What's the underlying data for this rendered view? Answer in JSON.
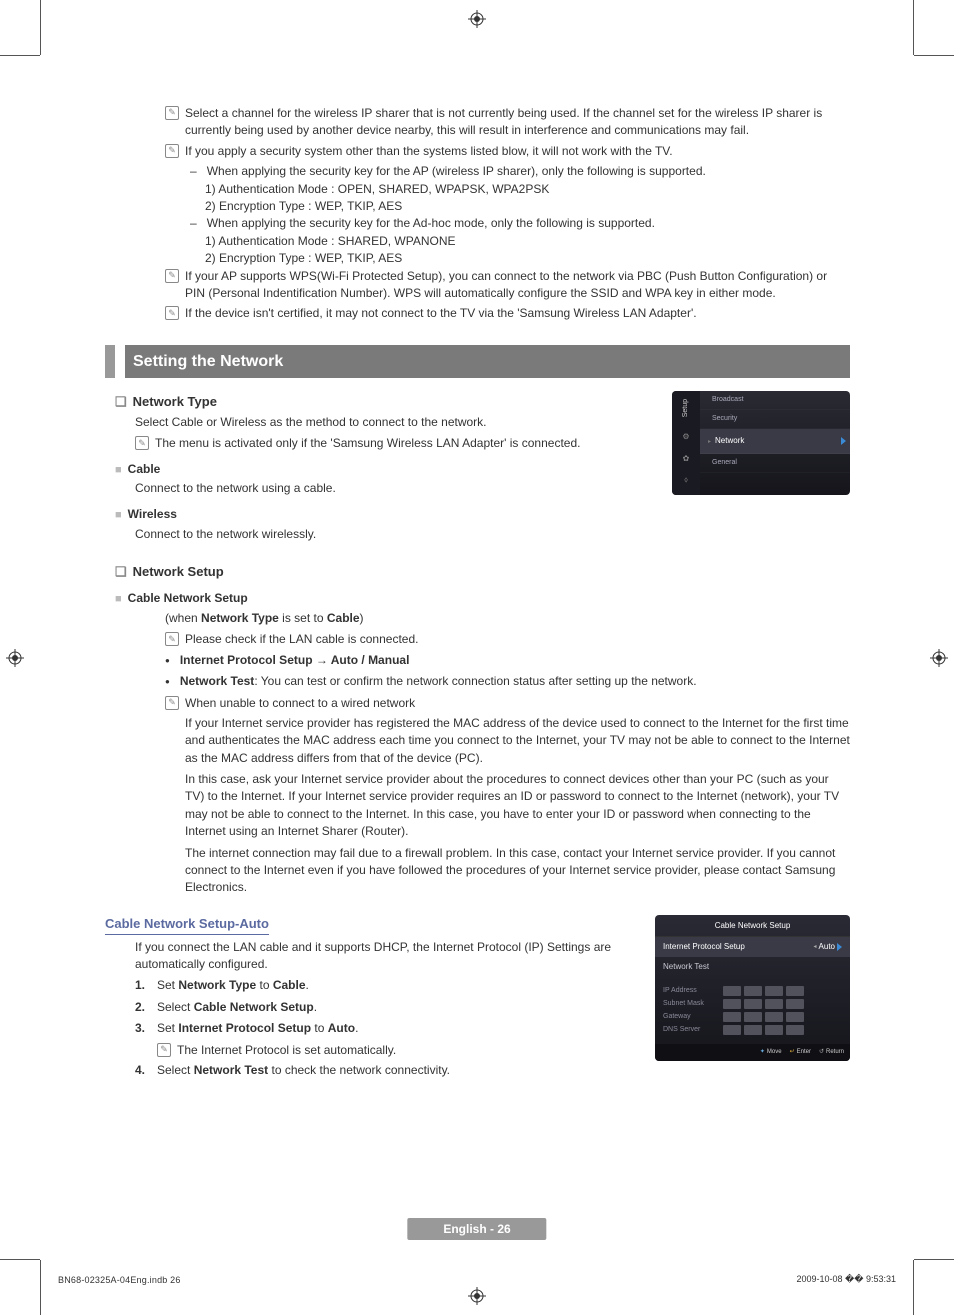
{
  "notes": {
    "n1": "Select a channel for the wireless IP sharer that is not currently being used. If the channel set for the wireless IP sharer is currently being used by another device nearby, this will result in interference and communications may fail.",
    "n2": "If you apply a security system other than the systems listed blow, it will not work with the TV.",
    "n2_a": "When applying the security key for the AP (wireless IP sharer), only the following is supported.",
    "n2_a1": "1) Authentication Mode : OPEN, SHARED, WPAPSK, WPA2PSK",
    "n2_a2": "2) Encryption Type : WEP, TKIP, AES",
    "n2_b": "When applying the security key for the Ad-hoc mode, only the following is supported.",
    "n2_b1": "1) Authentication Mode : SHARED, WPANONE",
    "n2_b2": "2) Encryption Type : WEP, TKIP, AES",
    "n3": "If your AP supports WPS(Wi-Fi Protected Setup), you can connect to the network via PBC (Push Button Configuration) or PIN (Personal Indentification Number). WPS will automatically configure the SSID and WPA key in either mode.",
    "n4": "If the device isn't certified, it may not connect to the TV via the 'Samsung Wireless LAN Adapter'."
  },
  "section_title": "Setting the Network",
  "network_type": {
    "heading": "Network Type",
    "intro": "Select Cable or Wireless as the method to connect to the network.",
    "note": "The menu is activated only if the 'Samsung Wireless LAN Adapter' is connected.",
    "cable_h": "Cable",
    "cable_p": "Connect to the network using a cable.",
    "wireless_h": "Wireless",
    "wireless_p": "Connect to the network wirelessly."
  },
  "network_setup": {
    "heading": "Network Setup",
    "cable_h": "Cable Network Setup",
    "when_prefix": "(when ",
    "when_bold1": "Network Type",
    "when_mid": " is set to ",
    "when_bold2": "Cable",
    "when_suffix": ")",
    "check_lan": "Please check if the LAN cable is connected.",
    "ips": "Internet Protocol Setup → Auto / Manual",
    "nettest_b": "Network Test",
    "nettest_rest": ": You can test or confirm the network connection status after setting up the network.",
    "unable": "When unable to connect to a wired network",
    "para1": "If your Internet service provider has registered the MAC address of the device used to connect to the Internet for the first time and authenticates the MAC address each time you connect to the Internet, your TV may not be able to connect to the Internet as the MAC address differs from that of the device (PC).",
    "para2": "In this case, ask your Internet service provider about the procedures to connect devices other than your PC (such as your TV) to the Internet. If your Internet service provider requires an ID or password to connect to the Internet (network), your TV may not be able to connect to the Internet. In this case, you have to enter your ID or password when connecting to the Internet using an Internet Sharer (Router).",
    "para3": "The internet connection may fail due to a firewall problem. In this case, contact your Internet service provider. If you cannot connect to the Internet even if you have followed the procedures of your Internet service provider, please contact Samsung Electronics."
  },
  "cable_auto": {
    "heading": "Cable Network Setup-Auto",
    "intro": "If you connect the LAN cable and it supports DHCP, the Internet Protocol (IP) Settings are automatically configured.",
    "step1_pre": "Set ",
    "step1_b1": "Network Type",
    "step1_mid": " to ",
    "step1_b2": "Cable",
    "step1_end": ".",
    "step2_pre": "Select ",
    "step2_b": "Cable Network Setup",
    "step2_end": ".",
    "step3_pre": "Set ",
    "step3_b1": "Internet Protocol Setup",
    "step3_mid": " to ",
    "step3_b2": "Auto",
    "step3_end": ".",
    "step3_note": "The Internet Protocol is set automatically.",
    "step4_pre": "Select ",
    "step4_b": "Network Test",
    "step4_end": " to check the network connectivity."
  },
  "osd_setup": {
    "rail_label": "Setup",
    "items": {
      "broadcast": "Broadcast",
      "security": "Security",
      "network": "Network",
      "general": "General"
    }
  },
  "osd_cable": {
    "title": "Cable Network Setup",
    "ips_label": "Internet Protocol Setup",
    "ips_value": "Auto",
    "nettest": "Network Test",
    "fields": {
      "ip": "IP Address",
      "subnet": "Subnet Mask",
      "gateway": "Gateway",
      "dns": "DNS Server"
    },
    "footer": {
      "move": "Move",
      "enter": "Enter",
      "ret": "Return"
    }
  },
  "footer": "English - 26",
  "imprint_left": "BN68-02325A-04Eng.indb   26",
  "imprint_right": "2009-10-08   �� 9:53:31"
}
